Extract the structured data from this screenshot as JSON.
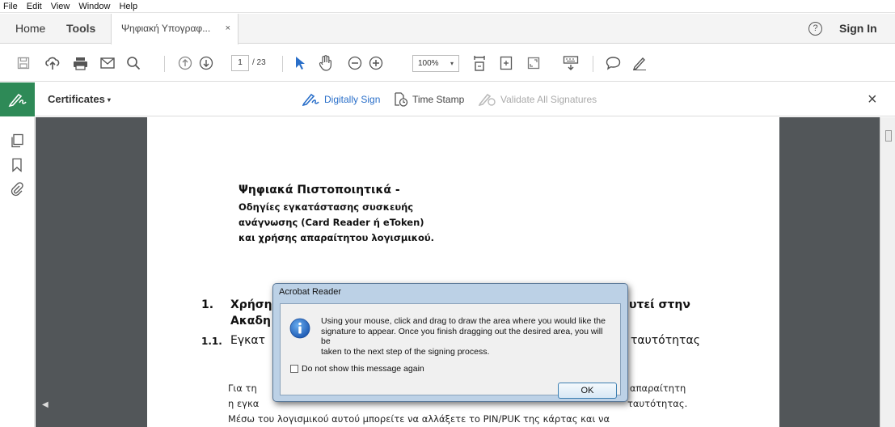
{
  "menu": [
    "File",
    "Edit",
    "View",
    "Window",
    "Help"
  ],
  "tabs": {
    "home": "Home",
    "tools": "Tools",
    "document": "Ψηφιακή Υπογραφ...",
    "close_glyph": "×"
  },
  "header": {
    "help_glyph": "?",
    "sign_in": "Sign In"
  },
  "toolbar": {
    "page_current": "1",
    "page_total": "/ 23",
    "zoom": "100%",
    "zoom_dropdown": "▾"
  },
  "sign_toolbar": {
    "certificates": "Certificates",
    "certificates_dropdown": "▾",
    "digitally_sign": "Digitally Sign",
    "time_stamp": "Time Stamp",
    "validate_all": "Validate All Signatures",
    "close_glyph": "×",
    "accent_color": "#2e8a57"
  },
  "document": {
    "title_line1": "Ψηφιακά Πιστοποιητικά  -",
    "title_line2": "Οδηγίες εγκατάστασης συσκευής",
    "title_line3": "ανάγνωσης (Card Reader ή eToken)",
    "title_line4": "και χρήσης απαραίτητου λογισμικού.",
    "heading1_num": "1.",
    "heading1_left": "Χρήση",
    "heading1_right": "υτεί  στην",
    "heading1_line2": "Ακαδη",
    "heading11_num": "1.1.",
    "heading11_left": "Εγκατ",
    "heading11_right": "ταυτότητας",
    "body_line1_left": "Για τη",
    "body_line1_right": "απαραίτητη",
    "body_line2_left": "η εγκα",
    "body_line2_right": "ταυτότητας.",
    "body_line3": "Μέσω  του  λογισμικού  αυτού  μπορείτε  να  αλλάξετε  το  PIN/PUK  της  κάρτας  και  να"
  },
  "dialog": {
    "title": "Acrobat Reader",
    "message": "Using your mouse, click and drag to draw the area where you would like the\nsignature to appear. Once you finish dragging out the desired area, you will be\ntaken to the next step of the signing process.",
    "checkbox_label": "Do not show this message again",
    "ok_button": "OK"
  }
}
